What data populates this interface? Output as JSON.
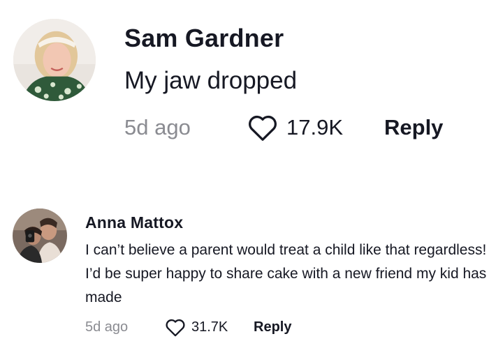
{
  "comments": [
    {
      "author": "Sam Gardner",
      "text": "My jaw dropped",
      "time": "5d ago",
      "likes": "17.9K",
      "reply_label": "Reply"
    },
    {
      "author": "Anna Mattox",
      "text": "I can’t believe a parent would treat a child like that regardless! I’d be super happy to share cake with a new friend my kid has made",
      "time": "5d ago",
      "likes": "31.7K",
      "reply_label": "Reply"
    }
  ],
  "colors": {
    "text": "#161823",
    "muted": "#8a8b91",
    "background": "#ffffff"
  }
}
